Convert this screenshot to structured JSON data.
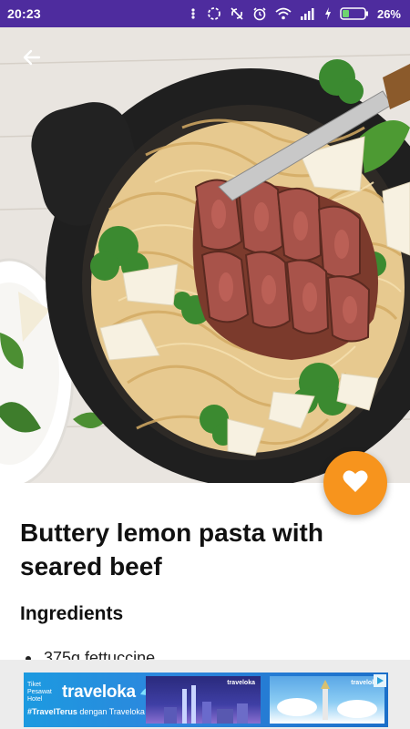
{
  "status_bar": {
    "time": "20:23",
    "battery_percent": "26%",
    "icons": [
      "notification-dots-icon",
      "circle-icon",
      "no-sync-icon",
      "alarm-icon",
      "wifi-icon",
      "signal-icon",
      "charging-icon",
      "battery-icon"
    ]
  },
  "header": {
    "back_icon": "arrow-left-icon"
  },
  "favorite": {
    "icon": "heart-icon",
    "color": "#f7941d"
  },
  "recipe": {
    "title": "Buttery lemon pasta with seared beef",
    "ingredients_heading": "Ingredients",
    "ingredients": [
      "375g fettuccine"
    ]
  },
  "ad": {
    "brand_small": "Tiket Pesawat Hotel",
    "brand_name": "traveloka",
    "tagline_prefix": "#TravelTerus",
    "tagline_rest": " dengan Traveloka Poin",
    "panel_brand": "traveloka",
    "adchoices_icon": "ad-choices-icon"
  },
  "colors": {
    "status_bar": "#4e2c9e",
    "fab": "#f7941d",
    "ad_blue": "#1c9ae0"
  }
}
